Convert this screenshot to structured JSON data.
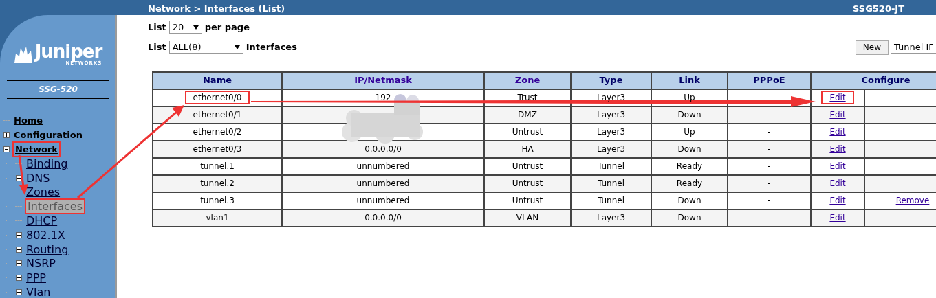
{
  "header": {
    "breadcrumb": "Network > Interfaces (List)",
    "device": "SSG520-JT"
  },
  "sidebar": {
    "logo_text": "Juniper",
    "logo_subtext": "NETWORKS",
    "model": "SSG-520",
    "items": [
      {
        "label": "Home",
        "selected": false,
        "marked": false
      },
      {
        "label": "Configuration",
        "selected": false,
        "marked": false,
        "expanded": false
      },
      {
        "label": "Network",
        "selected": false,
        "marked": true,
        "expanded": true,
        "children": [
          {
            "label": "Binding",
            "selected": false,
            "marked": false
          },
          {
            "label": "DNS",
            "selected": false,
            "marked": false,
            "expanded": false
          },
          {
            "label": "Zones",
            "selected": false,
            "marked": false
          },
          {
            "label": "Interfaces",
            "selected": true,
            "marked": true
          },
          {
            "label": "DHCP",
            "selected": false,
            "marked": false
          },
          {
            "label": "802.1X",
            "selected": false,
            "marked": false,
            "expanded": false
          },
          {
            "label": "Routing",
            "selected": false,
            "marked": false,
            "expanded": false
          },
          {
            "label": "NSRP",
            "selected": false,
            "marked": false,
            "expanded": false
          },
          {
            "label": "PPP",
            "selected": false,
            "marked": false,
            "expanded": false
          },
          {
            "label": "Vlan",
            "selected": false,
            "marked": false,
            "expanded": false
          }
        ]
      }
    ]
  },
  "controls": {
    "page_size": {
      "label": "List",
      "value": "20",
      "suffix": "per page"
    },
    "filter": {
      "label": "List",
      "value": "ALL(8)",
      "suffix": "Interfaces"
    },
    "new_button": "New",
    "type_select": "Tunnel IF"
  },
  "table": {
    "columns": [
      {
        "label": "Name",
        "sortable": false
      },
      {
        "label": "IP/Netmask",
        "sortable": true
      },
      {
        "label": "Zone",
        "sortable": true
      },
      {
        "label": "Type",
        "sortable": false
      },
      {
        "label": "Link",
        "sortable": false
      },
      {
        "label": "PPPoE",
        "sortable": false
      },
      {
        "label": "Configure",
        "sortable": false
      }
    ],
    "rows": [
      {
        "name": "ethernet0/0",
        "ip": "192",
        "zone": "Trust",
        "type": "Layer3",
        "link": "Up",
        "edit": "Edit",
        "name_marked": true,
        "edit_marked": true
      },
      {
        "name": "ethernet0/1",
        "zone": "DMZ",
        "type": "Layer3",
        "link": "Down",
        "pppoe": "-",
        "edit": "Edit",
        "name_marked": false,
        "edit_marked": false
      },
      {
        "name": "ethernet0/2",
        "zone": "Untrust",
        "type": "Layer3",
        "link": "Up",
        "pppoe": "-",
        "edit": "Edit",
        "name_marked": false,
        "edit_marked": false
      },
      {
        "name": "ethernet0/3",
        "ip": "0.0.0.0/0",
        "zone": "HA",
        "type": "Layer3",
        "link": "Down",
        "pppoe": "-",
        "edit": "Edit",
        "name_marked": false,
        "edit_marked": false
      },
      {
        "name": "tunnel.1",
        "ip": "unnumbered",
        "zone": "Untrust",
        "type": "Tunnel",
        "link": "Ready",
        "pppoe": "-",
        "edit": "Edit",
        "name_marked": false,
        "edit_marked": false
      },
      {
        "name": "tunnel.2",
        "ip": "unnumbered",
        "zone": "Untrust",
        "type": "Tunnel",
        "link": "Ready",
        "pppoe": "-",
        "edit": "Edit",
        "name_marked": false,
        "edit_marked": false
      },
      {
        "name": "tunnel.3",
        "ip": "unnumbered",
        "zone": "Untrust",
        "type": "Tunnel",
        "link": "Down",
        "pppoe": "-",
        "edit": "Edit",
        "remove": "Remove",
        "name_marked": false,
        "edit_marked": false
      },
      {
        "name": "vlan1",
        "ip": "0.0.0.0/0",
        "zone": "VLAN",
        "type": "Layer3",
        "link": "Down",
        "pppoe": "-",
        "edit": "Edit",
        "name_marked": false,
        "edit_marked": false
      }
    ]
  }
}
